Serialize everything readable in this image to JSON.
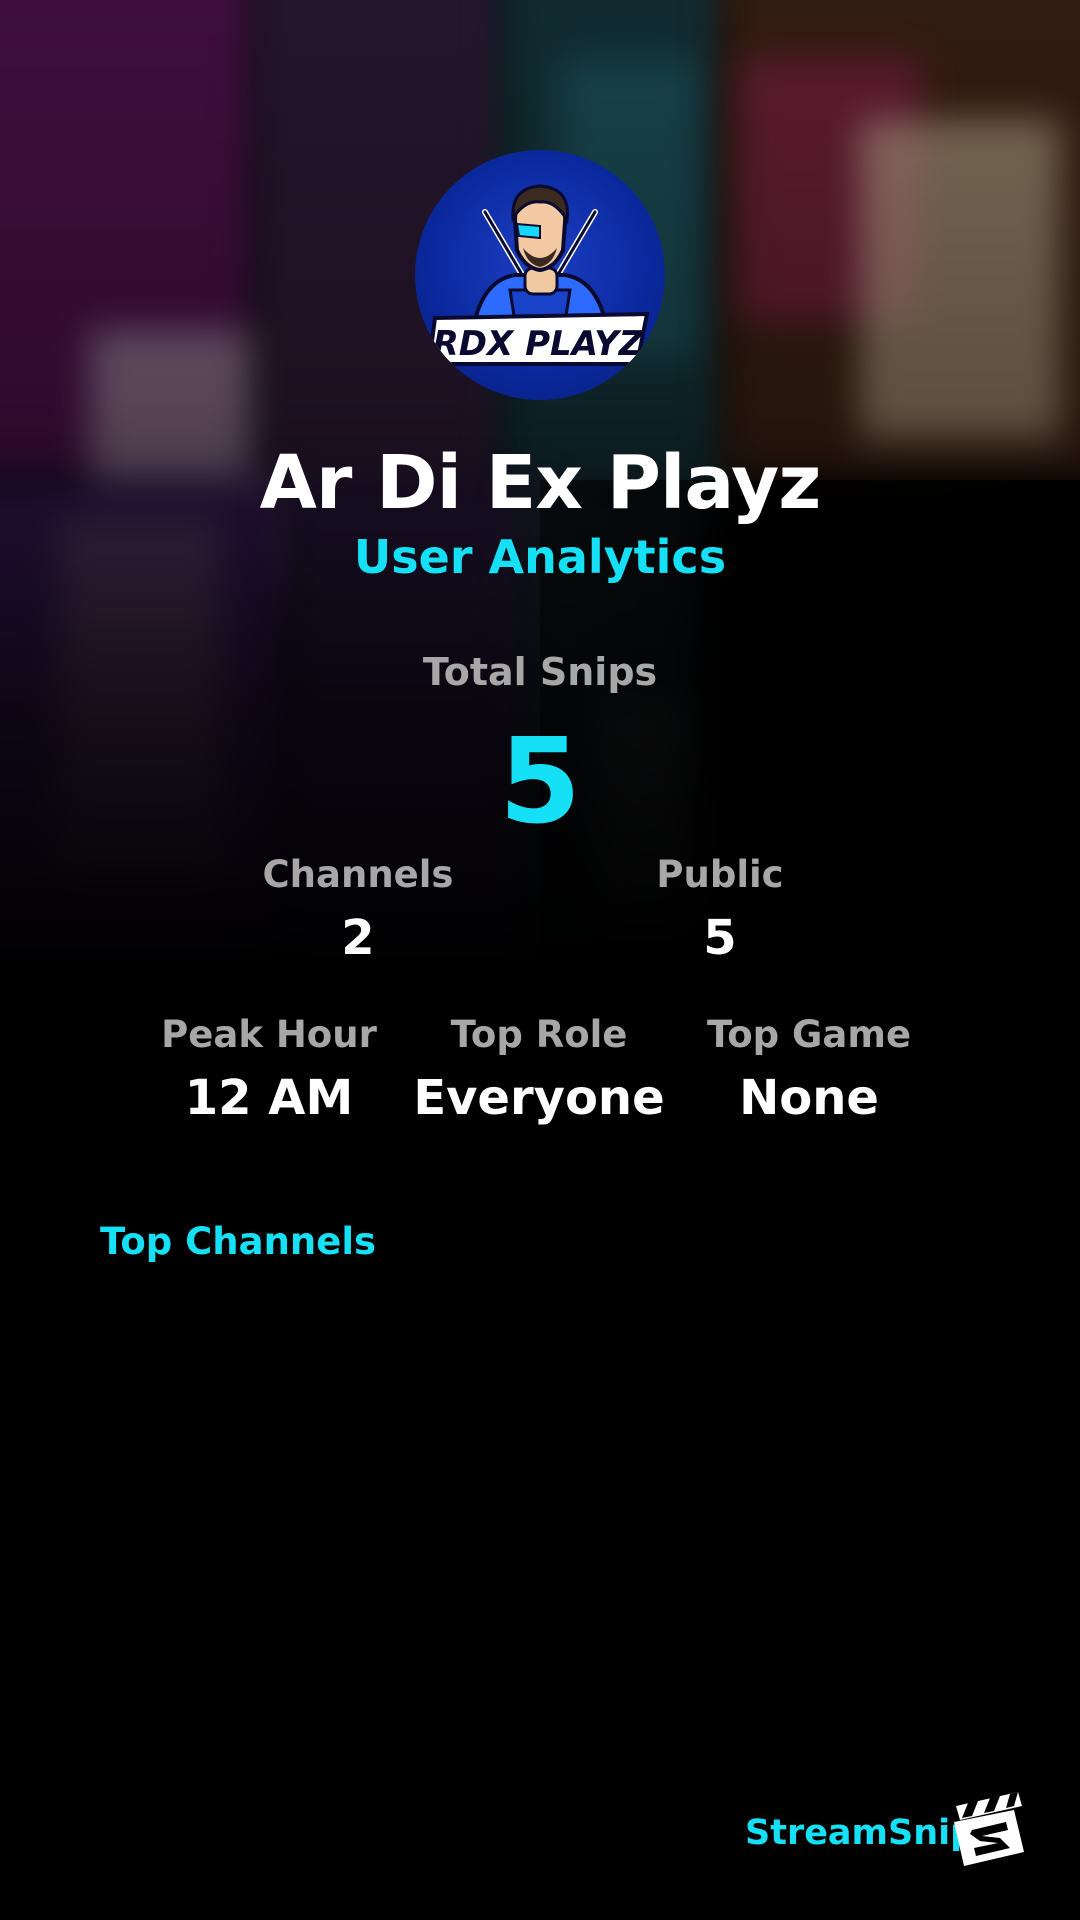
{
  "profile": {
    "avatar_text": "RDX PLAYZ",
    "name": "Ar Di Ex Playz",
    "subtitle": "User Analytics"
  },
  "totals": {
    "label": "Total Snips",
    "value": "5"
  },
  "stats_row1": [
    {
      "label": "Channels",
      "value": "2"
    },
    {
      "label": "Public",
      "value": "5"
    }
  ],
  "stats_row2": [
    {
      "label": "Peak Hour",
      "value": "12 AM"
    },
    {
      "label": "Top Role",
      "value": "Everyone"
    },
    {
      "label": "Top Game",
      "value": "None"
    }
  ],
  "top_channels": {
    "title": "Top Channels",
    "items": []
  },
  "branding": {
    "name": "StreamSnip",
    "logo_icon": "clapperboard-s-icon"
  },
  "colors": {
    "accent": "#16e0f5",
    "text": "#ffffff",
    "muted": "#a7a7a7",
    "background": "#000000",
    "avatar_blue": "#0b2aa0"
  }
}
